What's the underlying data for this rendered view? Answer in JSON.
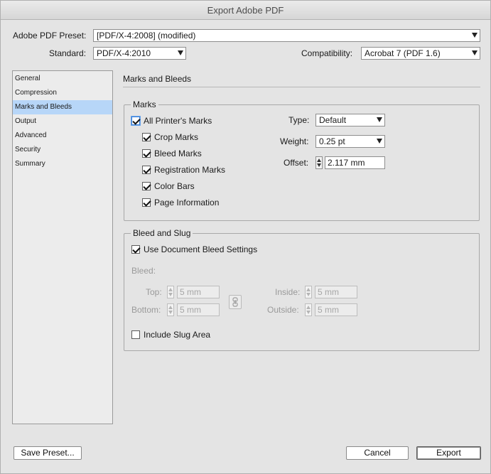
{
  "window": {
    "title": "Export Adobe PDF"
  },
  "preset": {
    "label": "Adobe PDF Preset:",
    "value": "[PDF/X-4:2008] (modified)"
  },
  "standard": {
    "label": "Standard:",
    "value": "PDF/X-4:2010"
  },
  "compatibility": {
    "label": "Compatibility:",
    "value": "Acrobat 7 (PDF 1.6)"
  },
  "sidebar": {
    "items": [
      {
        "label": "General"
      },
      {
        "label": "Compression"
      },
      {
        "label": "Marks and Bleeds"
      },
      {
        "label": "Output"
      },
      {
        "label": "Advanced"
      },
      {
        "label": "Security"
      },
      {
        "label": "Summary"
      }
    ],
    "selected": "Marks and Bleeds"
  },
  "panel": {
    "title": "Marks and Bleeds"
  },
  "marks": {
    "group_title": "Marks",
    "all_printers_marks": "All Printer's Marks",
    "crop_marks": "Crop Marks",
    "bleed_marks": "Bleed Marks",
    "registration_marks": "Registration Marks",
    "color_bars": "Color Bars",
    "page_information": "Page Information",
    "type_label": "Type:",
    "type_value": "Default",
    "weight_label": "Weight:",
    "weight_value": "0.25 pt",
    "offset_label": "Offset:",
    "offset_value": "2.117 mm"
  },
  "bleed_slug": {
    "group_title": "Bleed and Slug",
    "use_document_bleed": "Use Document Bleed Settings",
    "bleed_label": "Bleed:",
    "top_label": "Top:",
    "top_value": "5 mm",
    "bottom_label": "Bottom:",
    "bottom_value": "5 mm",
    "inside_label": "Inside:",
    "inside_value": "5 mm",
    "outside_label": "Outside:",
    "outside_value": "5 mm",
    "include_slug": "Include Slug Area"
  },
  "buttons": {
    "save_preset": "Save Preset...",
    "cancel": "Cancel",
    "export": "Export"
  },
  "icons": {
    "dropdown": "chevron-down-icon",
    "stepper": "stepper-icon",
    "chain": "chain-link-icon",
    "check": "checkmark-icon"
  },
  "colors": {
    "selection": "#b7d6f8",
    "background": "#e4e4e4",
    "focus": "#3b7fd4"
  }
}
